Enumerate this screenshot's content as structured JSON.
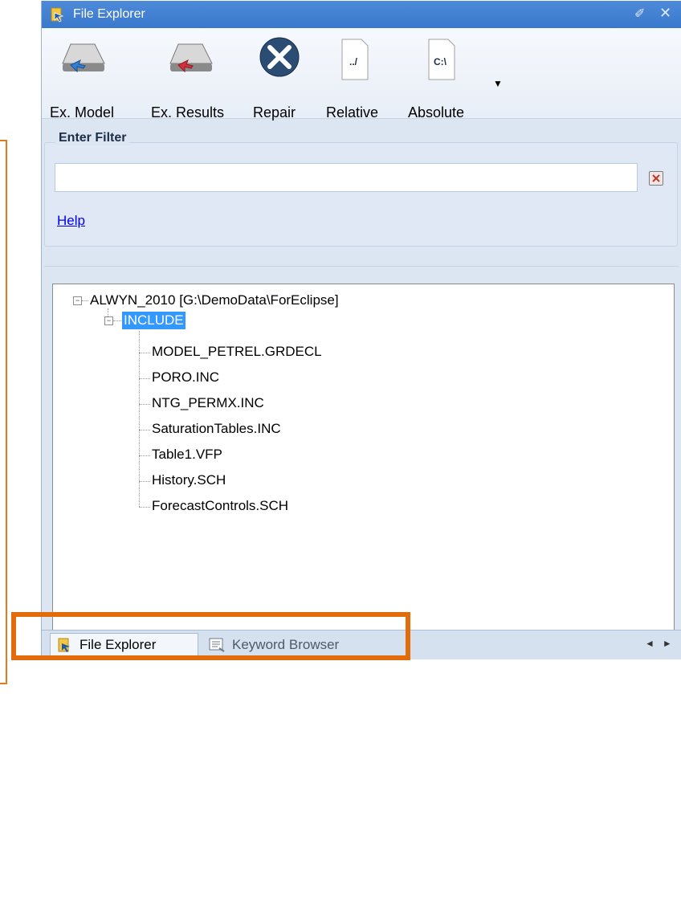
{
  "window": {
    "title": "File Explorer",
    "pin_glyph": "✐",
    "close_glyph": "✕"
  },
  "toolbar": {
    "buttons": [
      {
        "label": "Ex. Model",
        "icon": "export-model-icon"
      },
      {
        "label": "Ex. Results",
        "icon": "export-results-icon"
      },
      {
        "label": "Repair",
        "icon": "repair-icon"
      },
      {
        "label": "Relative",
        "icon": "relative-path-icon",
        "icon_text": "../"
      },
      {
        "label": "Absolute",
        "icon": "absolute-path-icon",
        "icon_text": "C:\\"
      }
    ],
    "more_glyph": "▼"
  },
  "filter": {
    "legend": "Enter Filter",
    "value": "",
    "help_label": "Help"
  },
  "tree": {
    "root": {
      "label": "ALWYN_2010 [G:\\DemoData\\ForEclipse]",
      "expander": "−"
    },
    "folder": {
      "label": "INCLUDE",
      "expander": "−",
      "selected": true
    },
    "files": [
      "MODEL_PETREL.GRDECL",
      "PORO.INC",
      "NTG_PERMX.INC",
      "SaturationTables.INC",
      "Table1.VFP",
      "History.SCH",
      "ForecastControls.SCH"
    ]
  },
  "tabs": {
    "items": [
      {
        "label": "File Explorer",
        "active": true,
        "icon": "file-explorer-icon"
      },
      {
        "label": "Keyword Browser",
        "active": false,
        "icon": "keyword-browser-icon"
      }
    ],
    "nav_left": "◄",
    "nav_right": "►"
  },
  "colors": {
    "title_bar": "#3a78cc",
    "panel_bg": "#dce6f3",
    "selection": "#3399ff",
    "annotation": "#e36c0a"
  }
}
